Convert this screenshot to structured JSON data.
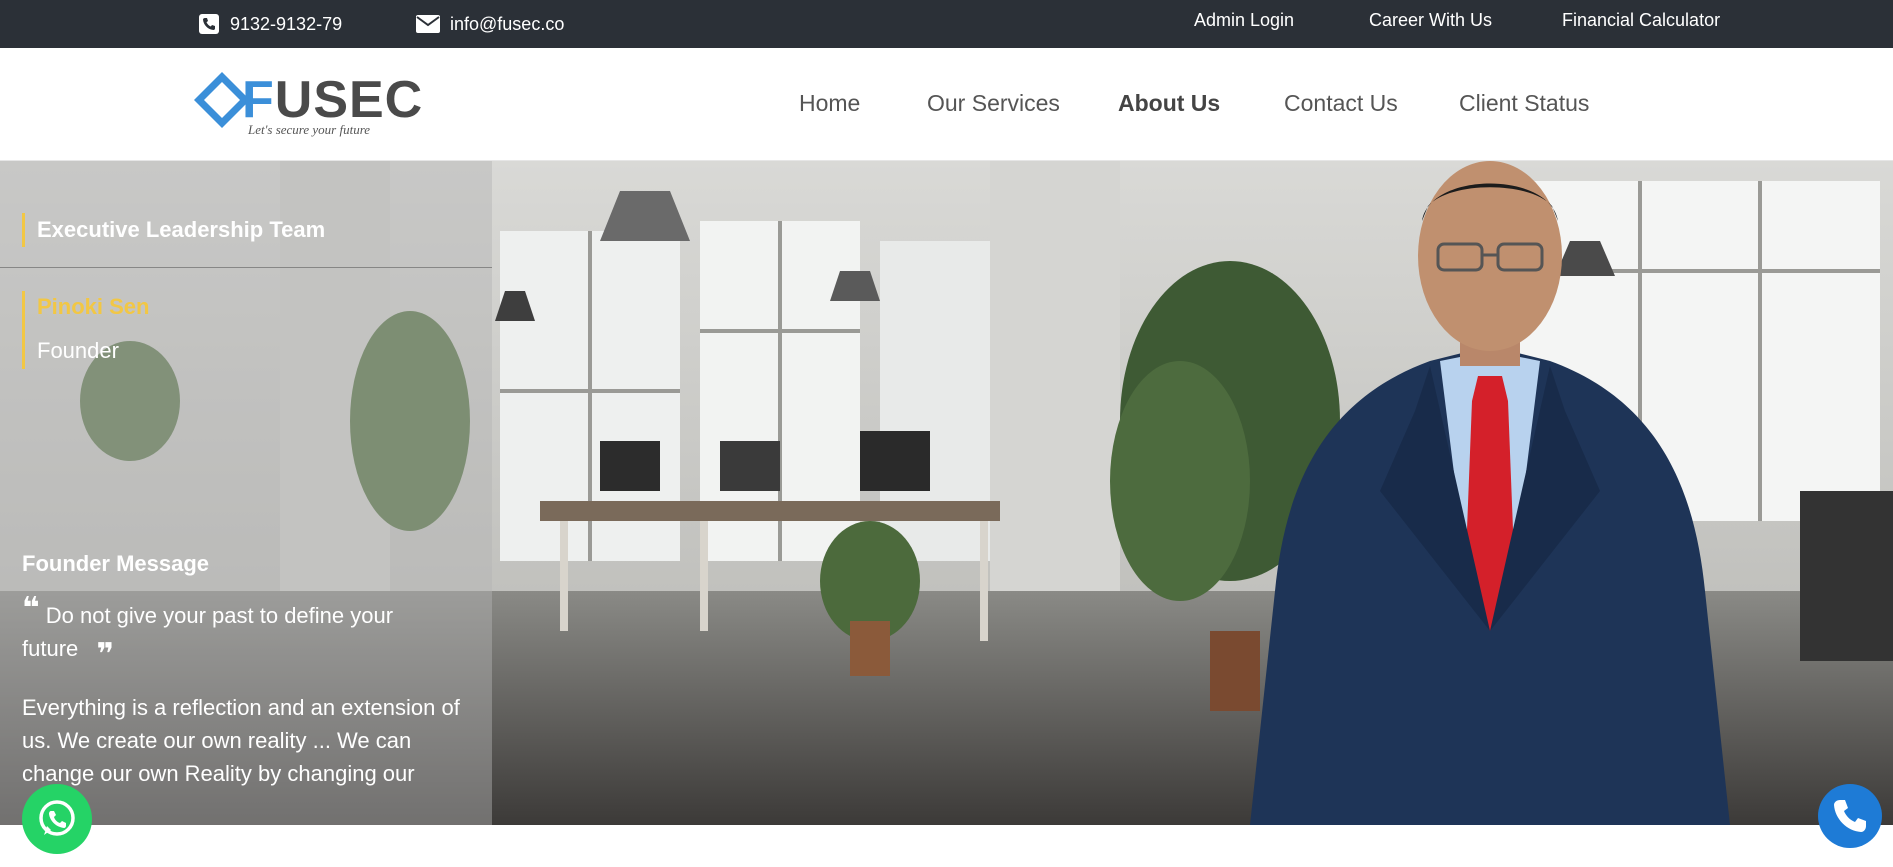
{
  "topbar": {
    "phone": {
      "icon": "phone-icon",
      "text": "9132-9132-79"
    },
    "email": {
      "icon": "envelope-icon",
      "text": "info@fusec.co"
    },
    "links": {
      "admin_login": "Admin Login",
      "career": "Career With Us",
      "calculator": "Financial Calculator"
    }
  },
  "header": {
    "logo": {
      "prefix": "F",
      "rest": "USEC",
      "tagline": "Let's secure your future"
    },
    "nav": {
      "home": "Home",
      "services": "Our Services",
      "about": "About Us",
      "contact": "Contact Us",
      "client_status": "Client Status"
    },
    "active_nav": "About Us"
  },
  "hero": {
    "section_heading": "Executive Leadership Team",
    "person": {
      "name": "Pinoki Sen",
      "role": "Founder"
    },
    "message_heading": "Founder Message",
    "quote": "Do not give your past to define your future",
    "message": "Everything is a reflection and an extension of us. We create our own reality ... We can change our own Reality by changing our"
  },
  "floating": {
    "whatsapp_icon": "whatsapp-icon",
    "call_icon": "phone-call-icon"
  },
  "colors": {
    "topbar_bg": "#2b3037",
    "accent_yellow": "#f2c744",
    "logo_blue": "#3b8fd9",
    "whatsapp_green": "#25d366",
    "call_blue": "#1e7bd6"
  }
}
